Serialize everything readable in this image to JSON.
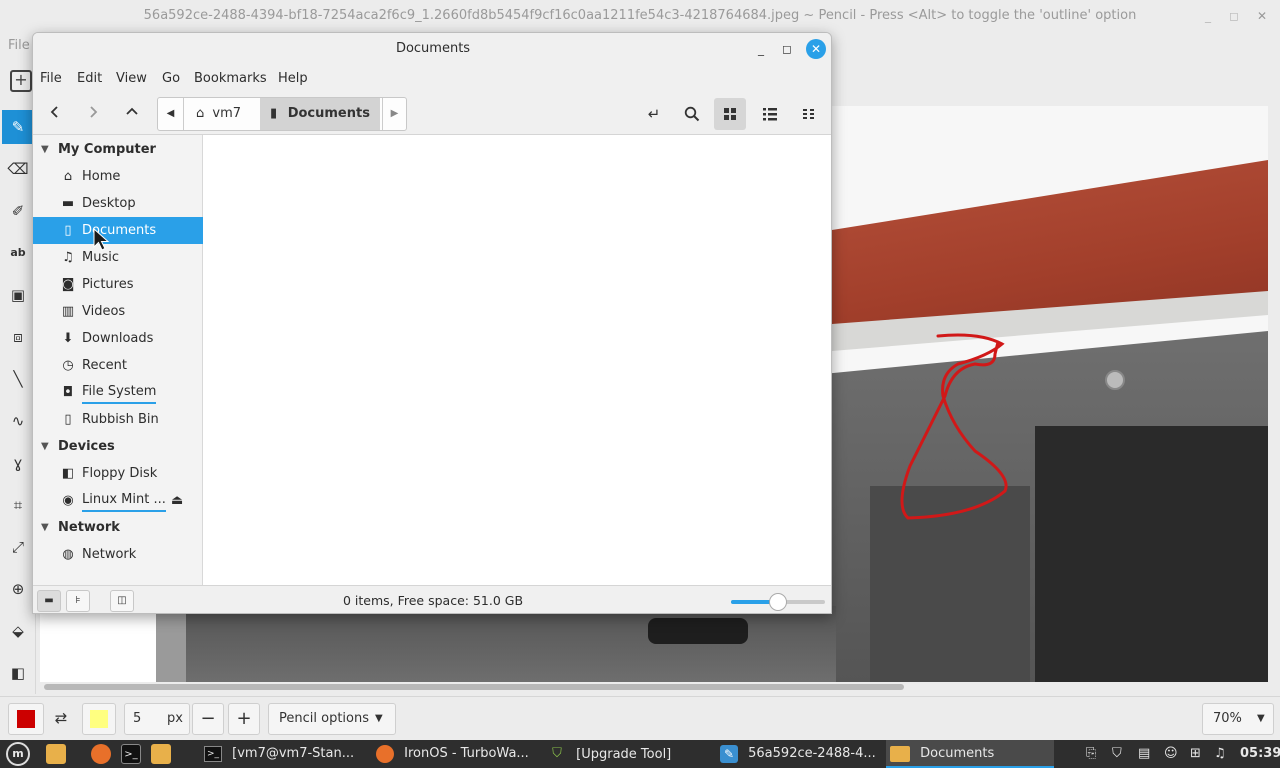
{
  "pinta": {
    "title": "56a592ce-2488-4394-bf18-7254aca2f6c9_1.2660fd8b5454f9cf16c0aa1211fe54c3-4218764684.jpeg ~ Pencil - Press <Alt> to toggle the 'outline' option",
    "menu_label": "File",
    "brush_width": "5",
    "unit": "px",
    "minus": "−",
    "plus": "+",
    "tool_options": "Pencil options",
    "zoom": "70%",
    "primary_color": "#cc0000",
    "secondary_color": "#ffff80"
  },
  "fm": {
    "title": "Documents",
    "menu": [
      "File",
      "Edit",
      "View",
      "Go",
      "Bookmarks",
      "Help"
    ],
    "breadcrumb": {
      "home": "vm7",
      "current": "Documents"
    },
    "sidebar": {
      "my_computer": {
        "label": "My Computer",
        "items": [
          {
            "label": "Home",
            "icon": "home-icon"
          },
          {
            "label": "Desktop",
            "icon": "desktop-icon"
          },
          {
            "label": "Documents",
            "icon": "document-icon"
          },
          {
            "label": "Music",
            "icon": "music-icon"
          },
          {
            "label": "Pictures",
            "icon": "camera-icon"
          },
          {
            "label": "Videos",
            "icon": "film-icon"
          },
          {
            "label": "Downloads",
            "icon": "download-icon"
          },
          {
            "label": "Recent",
            "icon": "clock-icon"
          },
          {
            "label": "File System",
            "icon": "drive-icon"
          },
          {
            "label": "Rubbish Bin",
            "icon": "trash-icon"
          }
        ]
      },
      "devices": {
        "label": "Devices",
        "items": [
          {
            "label": "Floppy Disk",
            "icon": "floppy-icon"
          },
          {
            "label": "Linux Mint ...",
            "icon": "disc-icon"
          }
        ]
      },
      "network": {
        "label": "Network",
        "items": [
          {
            "label": "Network",
            "icon": "globe-icon"
          }
        ]
      }
    },
    "status": "0 items, Free space: 51.0 GB",
    "zoom_level": 0.5
  },
  "taskbar": {
    "tasks": [
      {
        "label": "[vm7@vm7-Stan...",
        "icon": "terminal-icon"
      },
      {
        "label": "IronOS - TurboWa...",
        "icon": "firefox-icon"
      },
      {
        "label": "[Upgrade Tool]",
        "icon": "shield-icon"
      },
      {
        "label": "56a592ce-2488-4...",
        "icon": "pinta-icon"
      },
      {
        "label": "Documents",
        "icon": "folder-icon"
      }
    ],
    "clock": "05:39"
  }
}
